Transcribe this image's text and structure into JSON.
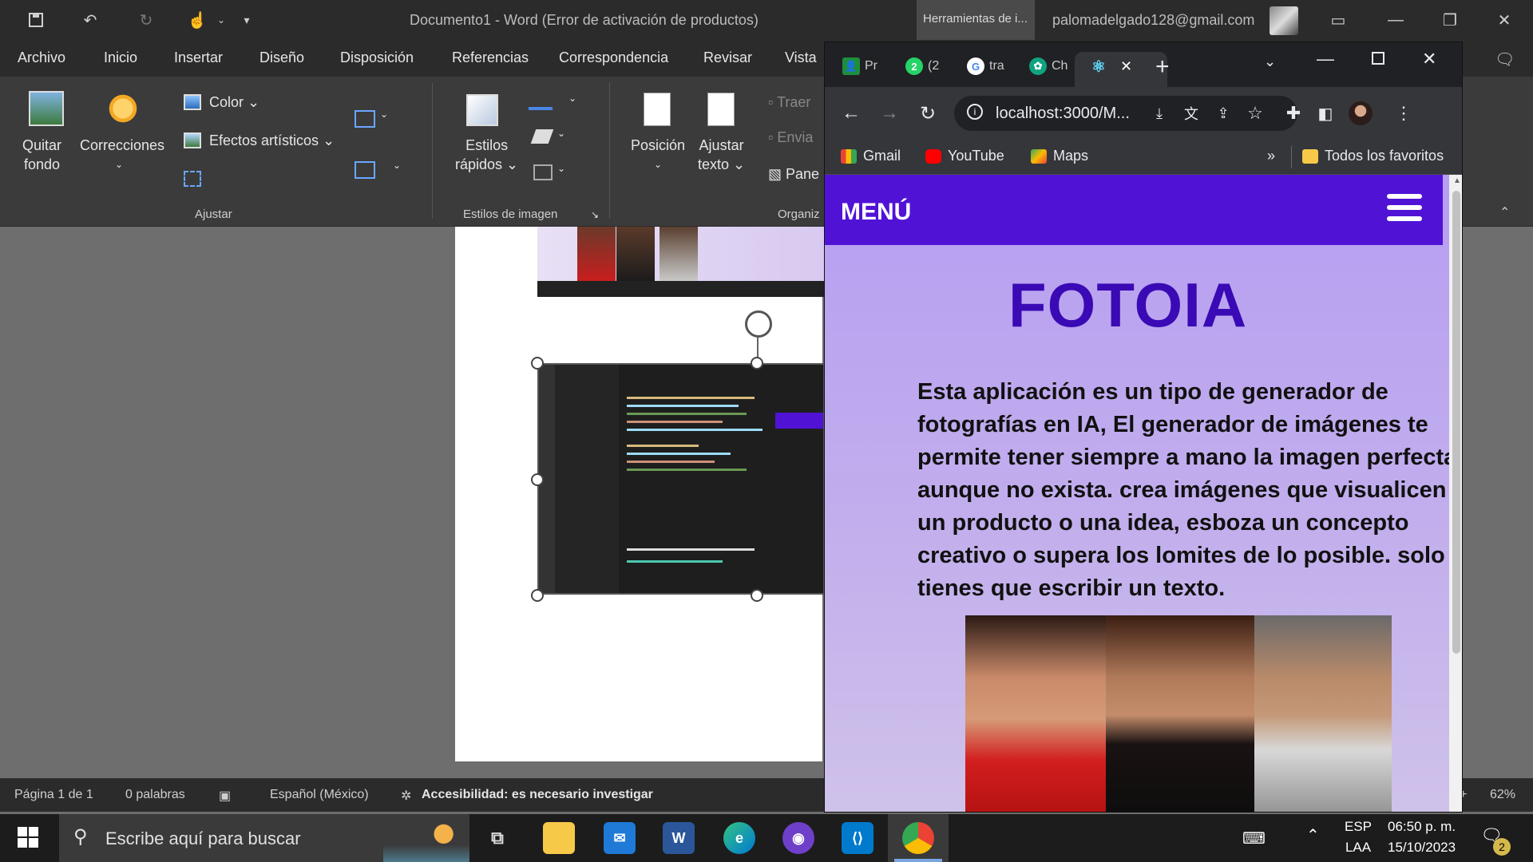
{
  "word": {
    "title": "Documento1  -  Word (Error de activación de productos)",
    "contextual_tab": "Herramientas de i...",
    "account": "palomadelgado128@gmail.com",
    "tabs": [
      "Archivo",
      "Inicio",
      "Insertar",
      "Diseño",
      "Disposición",
      "Referencias",
      "Correspondencia",
      "Revisar",
      "Vista"
    ],
    "ribbon": {
      "quitar_fondo": [
        "Quitar",
        "fondo"
      ],
      "correcciones": "Correcciones",
      "color": "Color",
      "efectos": "Efectos artísticos",
      "estilos_rapidos": [
        "Estilos",
        "rápidos"
      ],
      "posicion": "Posición",
      "ajustar_texto": [
        "Ajustar",
        "texto"
      ],
      "traer": "Traer",
      "enviar": "Envia",
      "panel": "Pane",
      "group_ajustar": "Ajustar",
      "group_estilos": "Estilos de imagen",
      "group_organizar": "Organiz"
    },
    "status": {
      "page": "Página 1 de 1",
      "words": "0 palabras",
      "language": "Español (México)",
      "accessibility": "Accesibilidad: es necesario investigar",
      "zoom": "62%"
    }
  },
  "chrome": {
    "tabs": [
      {
        "label": "Pr",
        "icon": "classroom-icon",
        "color": "#1e8e3e"
      },
      {
        "label": "(2",
        "icon": "whatsapp-icon",
        "color": "#25d366"
      },
      {
        "label": "tra",
        "icon": "google-icon",
        "color": "#4285f4"
      },
      {
        "label": "Ch",
        "icon": "chatgpt-icon",
        "color": "#10a37f"
      },
      {
        "label": "",
        "icon": "react-icon",
        "color": "#61dafb"
      }
    ],
    "url": "localhost:3000/M...",
    "bookmarks": [
      "Gmail",
      "YouTube",
      "Maps"
    ],
    "all_bookmarks": "Todos los favoritos",
    "overflow": "»"
  },
  "page": {
    "nav_title": "MENÚ",
    "title": "FOTOIA",
    "description": "Esta aplicación es un tipo de generador de fotografías en IA, El generador de imágenes te permite tener siempre a mano la imagen perfecta aunque no exista. crea imágenes que visualicen un producto o una idea, esboza un concepto creativo o supera los lomites de lo posible. solo tienes que escribir un texto."
  },
  "taskbar": {
    "search_placeholder": "Escribe aquí para buscar",
    "lang_top": "ESP",
    "lang_bottom": "LAA",
    "time": "06:50 p. m.",
    "date": "15/10/2023",
    "notifications": "2"
  },
  "colors": {
    "page_nav": "#5013d6",
    "page_title": "#3a0ab5",
    "page_bg": "#b69ef2"
  }
}
